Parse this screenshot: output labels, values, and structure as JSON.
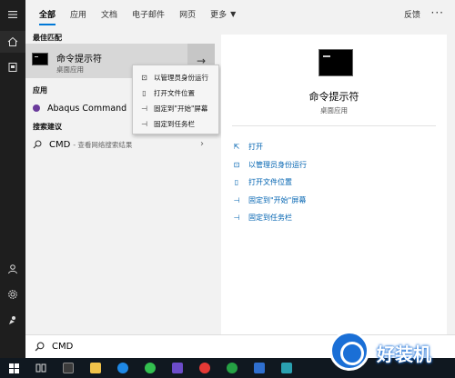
{
  "tabs": [
    {
      "label": "全部",
      "active": true
    },
    {
      "label": "应用",
      "active": false
    },
    {
      "label": "文档",
      "active": false
    },
    {
      "label": "电子邮件",
      "active": false
    },
    {
      "label": "网页",
      "active": false
    },
    {
      "label": "更多",
      "active": false
    }
  ],
  "header": {
    "feedback": "反馈",
    "more_dots": "···"
  },
  "results": {
    "best_match_heading": "最佳匹配",
    "best_match": {
      "name": "命令提示符",
      "subtitle": "桌面应用"
    },
    "apps_heading": "应用",
    "app_item": "Abaqus Command",
    "web_heading": "搜索建议",
    "web_item": {
      "query": "CMD",
      "hint": "- 查看网络搜索结果"
    }
  },
  "context_menu": [
    {
      "label": "以管理员身份运行",
      "icon": "shield-run-icon"
    },
    {
      "label": "打开文件位置",
      "icon": "file-location-icon"
    },
    {
      "label": "固定到\"开始\"屏幕",
      "icon": "pin-icon"
    },
    {
      "label": "固定到任务栏",
      "icon": "pin-icon"
    }
  ],
  "detail": {
    "title": "命令提示符",
    "subtitle": "桌面应用",
    "actions": [
      {
        "label": "打开",
        "icon": "open-icon"
      },
      {
        "label": "以管理员身份运行",
        "icon": "shield-run-icon"
      },
      {
        "label": "打开文件位置",
        "icon": "file-location-icon"
      },
      {
        "label": "固定到\"开始\"屏幕",
        "icon": "pin-icon"
      },
      {
        "label": "固定到任务栏",
        "icon": "pin-icon"
      }
    ]
  },
  "search": {
    "value": "CMD"
  },
  "watermark": {
    "text": "好装机"
  },
  "colors": {
    "accent": "#0078d7",
    "link": "#0063b1",
    "taskbar": "#101820",
    "rail": "#1e1e1e"
  }
}
